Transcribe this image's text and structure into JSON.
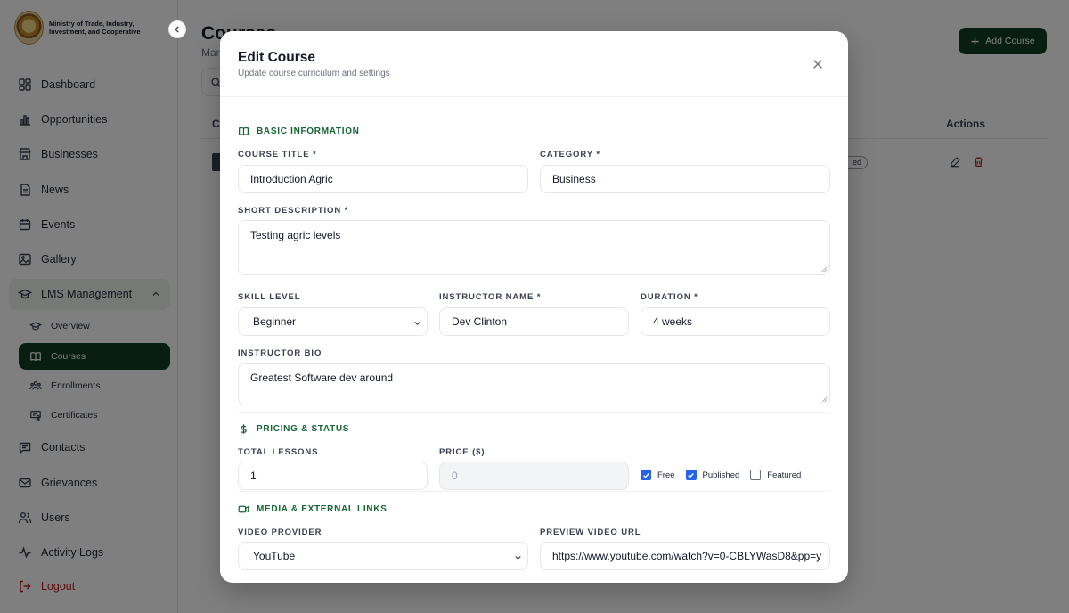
{
  "brand": {
    "name": "Ministry of Trade, Industry, Investment, and Cooperative"
  },
  "sidebar": {
    "items": [
      {
        "label": "Dashboard",
        "icon": "dashboard-icon"
      },
      {
        "label": "Opportunities",
        "icon": "chart-bar-icon"
      },
      {
        "label": "Businesses",
        "icon": "store-icon"
      },
      {
        "label": "News",
        "icon": "document-icon"
      },
      {
        "label": "Events",
        "icon": "calendar-icon"
      },
      {
        "label": "Gallery",
        "icon": "image-icon"
      },
      {
        "label": "LMS Management",
        "icon": "graduation-cap-icon",
        "expanded": true
      }
    ],
    "sub_items": [
      {
        "label": "Overview",
        "icon": "graduation-cap-icon"
      },
      {
        "label": "Courses",
        "icon": "book-icon",
        "active": true
      },
      {
        "label": "Enrollments",
        "icon": "users-icon"
      },
      {
        "label": "Certificates",
        "icon": "certificate-icon"
      }
    ],
    "items_after": [
      {
        "label": "Contacts",
        "icon": "message-icon"
      },
      {
        "label": "Grievances",
        "icon": "mail-icon"
      },
      {
        "label": "Users",
        "icon": "users-icon"
      },
      {
        "label": "Activity Logs",
        "icon": "activity-icon"
      }
    ],
    "logout": "Logout"
  },
  "page": {
    "title": "Courses",
    "subtitle": "Man",
    "add_button": "Add Course",
    "table": {
      "first_header": "C",
      "actions_header": "Actions",
      "row_status": "ed"
    }
  },
  "modal": {
    "title": "Edit Course",
    "subtitle": "Update course curriculum and settings",
    "sections": {
      "basic": "BASIC INFORMATION",
      "pricing": "PRICING & STATUS",
      "media": "MEDIA & EXTERNAL LINKS"
    },
    "fields": {
      "course_title": {
        "label": "COURSE TITLE *",
        "value": "Introduction Agric"
      },
      "category": {
        "label": "CATEGORY *",
        "value": "Business"
      },
      "short_description": {
        "label": "SHORT DESCRIPTION *",
        "value": "Testing agric levels"
      },
      "skill_level": {
        "label": "SKILL LEVEL",
        "value": "Beginner"
      },
      "instructor_name": {
        "label": "INSTRUCTOR NAME *",
        "value": "Dev Clinton"
      },
      "duration": {
        "label": "DURATION *",
        "value": "4 weeks"
      },
      "instructor_bio": {
        "label": "INSTRUCTOR BIO",
        "value": "Greatest Software dev around"
      },
      "total_lessons": {
        "label": "TOTAL LESSONS",
        "value": "1"
      },
      "price": {
        "label": "PRICE ($)",
        "placeholder": "0"
      },
      "video_provider": {
        "label": "VIDEO PROVIDER",
        "value": "YouTube"
      },
      "preview_video_url": {
        "label": "PREVIEW VIDEO URL",
        "value": "https://www.youtube.com/watch?v=0-CBLYWasD8&pp=y"
      }
    },
    "checkboxes": [
      {
        "label": "Free",
        "checked": true
      },
      {
        "label": "Published",
        "checked": true
      },
      {
        "label": "Featured",
        "checked": false
      }
    ]
  },
  "colors": {
    "brand_green": "#0f3d21",
    "section_green": "#166534",
    "danger": "#b91c1c",
    "checkbox_blue": "#2563eb"
  }
}
